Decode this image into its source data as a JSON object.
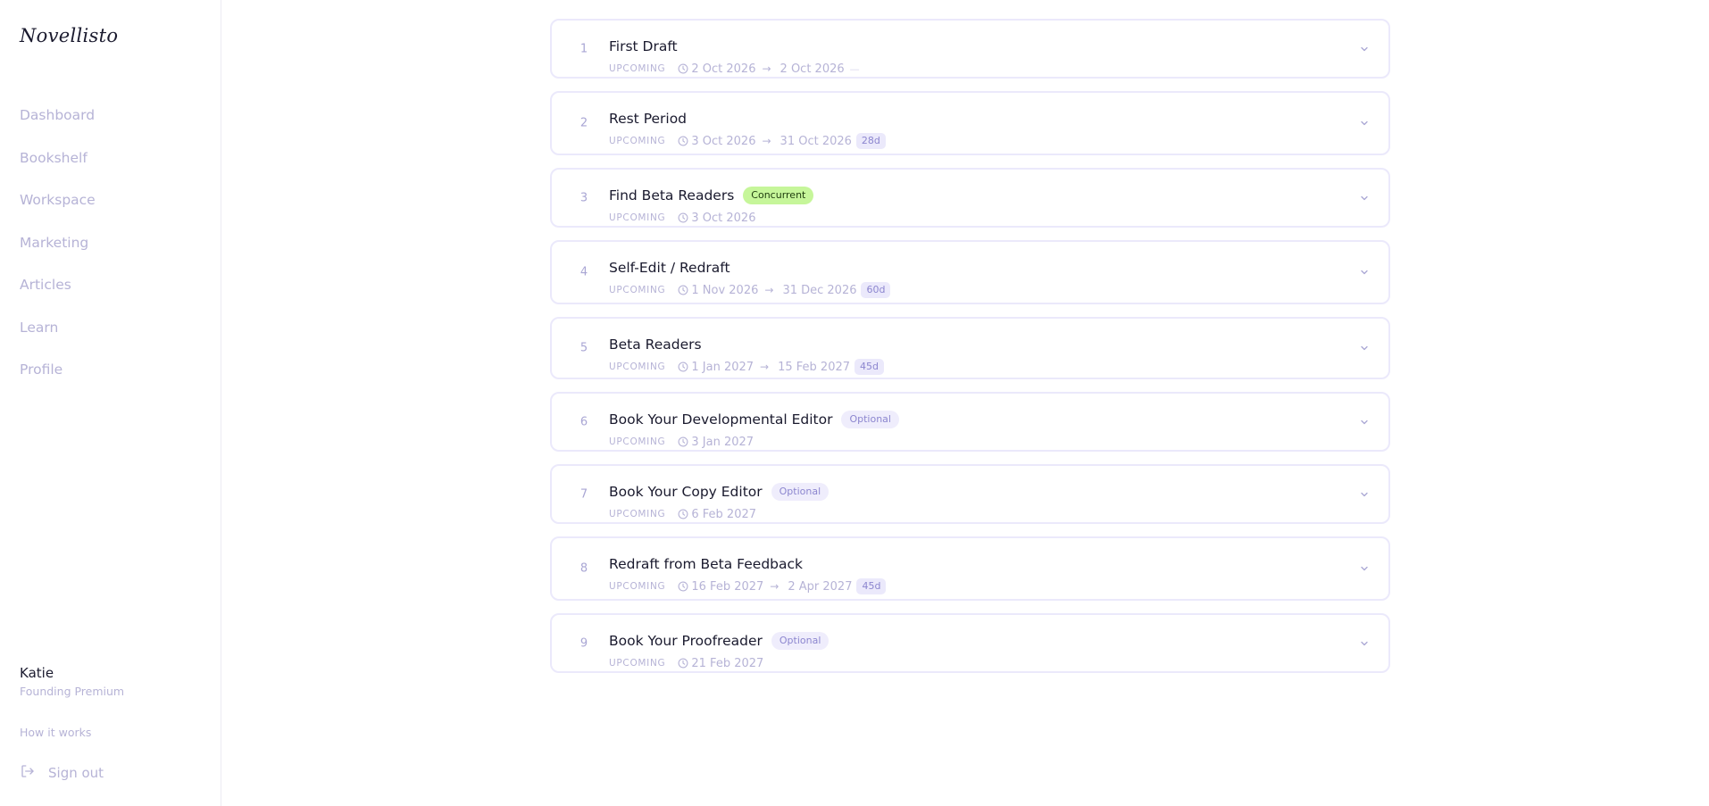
{
  "app": {
    "logo_text": "Novellisto"
  },
  "sidebar": {
    "items": [
      {
        "label": "Dashboard"
      },
      {
        "label": "Bookshelf"
      },
      {
        "label": "Workspace"
      },
      {
        "label": "Marketing"
      },
      {
        "label": "Articles"
      },
      {
        "label": "Learn"
      },
      {
        "label": "Profile"
      }
    ],
    "user_name": "Katie",
    "user_plan": "Founding Premium",
    "how_it_works": "How it works",
    "sign_out": "Sign out",
    "sign_out_icon": "sign-out-icon"
  },
  "colors": {
    "muted_text": "#b6b3d6",
    "card_border": "#ebe9fb",
    "concurrent_badge": "#c6f69a",
    "optional_badge": "#efedfc",
    "duration_badge": "#ebe9fb"
  },
  "stages": [
    {
      "num": "1",
      "title": "First Draft",
      "badge": "",
      "status": "UPCOMING",
      "start": "2 Oct 2026",
      "arrow": "→",
      "end": "2 Oct 2026",
      "duration": "",
      "trailing": "—"
    },
    {
      "num": "2",
      "title": "Rest Period",
      "badge": "",
      "status": "UPCOMING",
      "start": "3 Oct 2026",
      "arrow": "→",
      "end": "31 Oct 2026",
      "duration": "28d",
      "trailing": ""
    },
    {
      "num": "3",
      "title": "Find Beta Readers",
      "badge": "Concurrent",
      "status": "UPCOMING",
      "start": "3 Oct 2026",
      "arrow": "",
      "end": "",
      "duration": "",
      "trailing": ""
    },
    {
      "num": "4",
      "title": "Self-Edit / Redraft",
      "badge": "",
      "status": "UPCOMING",
      "start": "1 Nov 2026",
      "arrow": "→",
      "end": "31 Dec 2026",
      "duration": "60d",
      "trailing": ""
    },
    {
      "num": "5",
      "title": "Beta Readers",
      "badge": "",
      "status": "UPCOMING",
      "start": "1 Jan 2027",
      "arrow": "→",
      "end": "15 Feb 2027",
      "duration": "45d",
      "trailing": ""
    },
    {
      "num": "6",
      "title": "Book Your Developmental Editor",
      "badge": "Optional",
      "status": "UPCOMING",
      "start": "3 Jan 2027",
      "arrow": "",
      "end": "",
      "duration": "",
      "trailing": ""
    },
    {
      "num": "7",
      "title": "Book Your Copy Editor",
      "badge": "Optional",
      "status": "UPCOMING",
      "start": "6 Feb 2027",
      "arrow": "",
      "end": "",
      "duration": "",
      "trailing": ""
    },
    {
      "num": "8",
      "title": "Redraft from Beta Feedback",
      "badge": "",
      "status": "UPCOMING",
      "start": "16 Feb 2027",
      "arrow": "→",
      "end": "2 Apr 2027",
      "duration": "45d",
      "trailing": ""
    },
    {
      "num": "9",
      "title": "Book Your Proofreader",
      "badge": "Optional",
      "status": "UPCOMING",
      "start": "21 Feb 2027",
      "arrow": "",
      "end": "",
      "duration": "",
      "trailing": ""
    }
  ]
}
